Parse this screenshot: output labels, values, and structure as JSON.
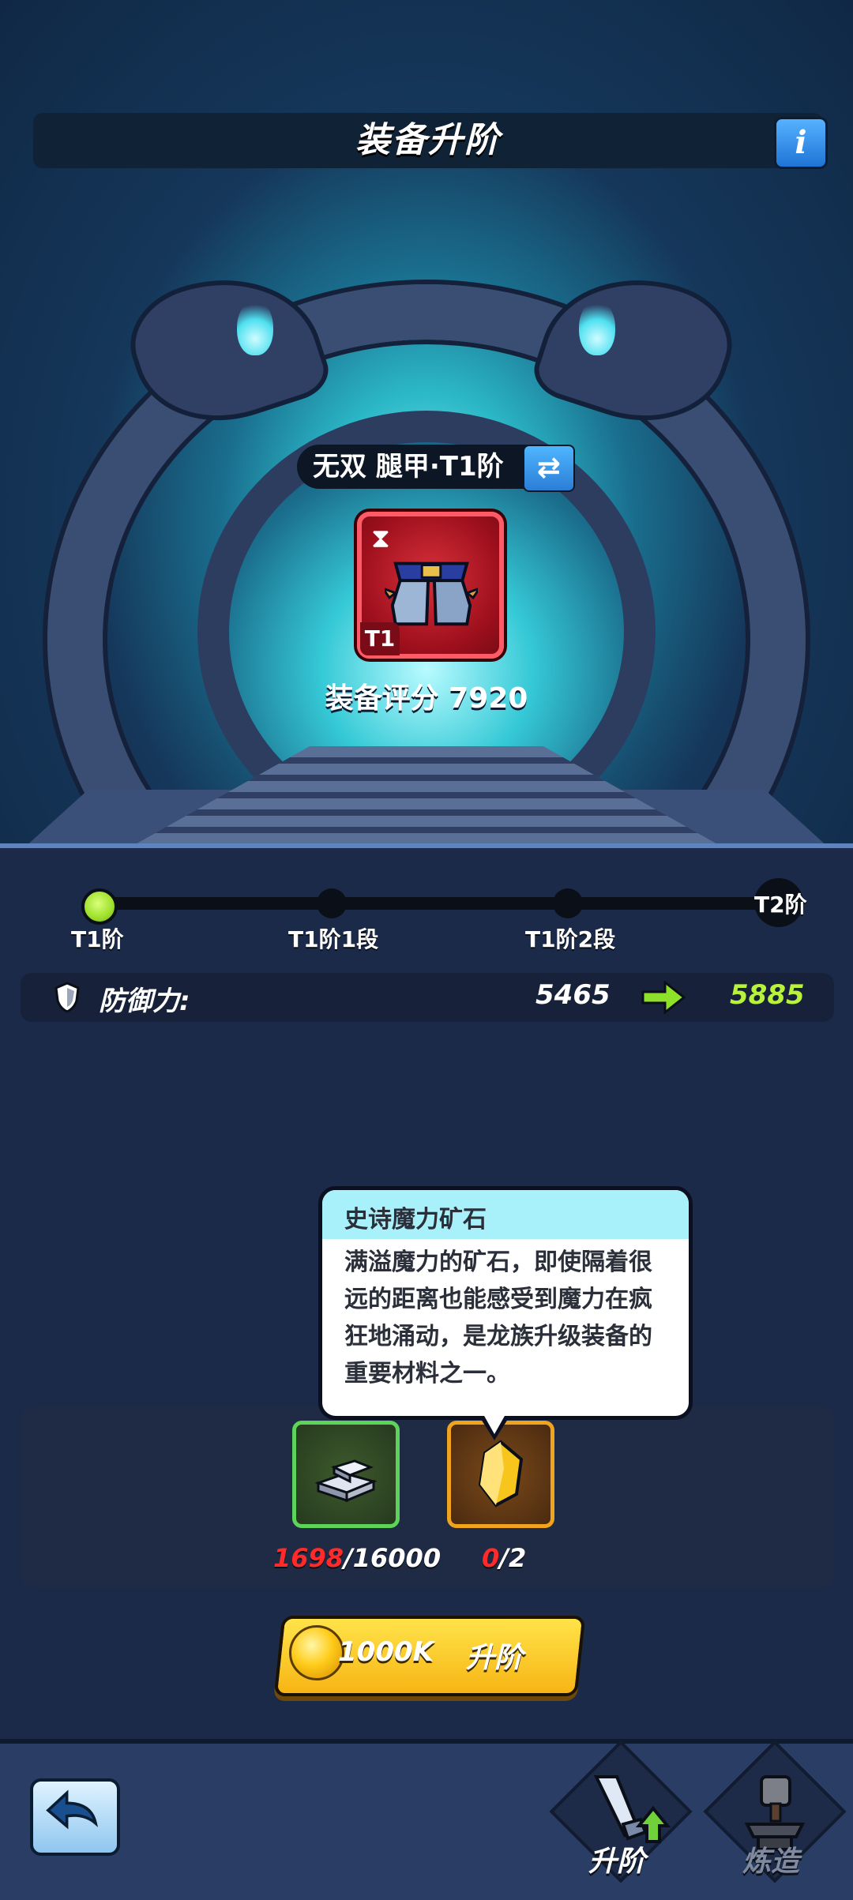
{
  "header": {
    "title": "装备升阶",
    "info_icon": "info-icon"
  },
  "item": {
    "name": "无双 腿甲·T1阶",
    "tier_badge": "T1",
    "score_text": "装备评分 7920",
    "frame_color": "#ff5a66"
  },
  "progress": {
    "stages": [
      "T1阶",
      "T1阶1段",
      "T1阶2段",
      "T2阶"
    ],
    "current_index": 0,
    "accent_color": "#9de02a"
  },
  "stat": {
    "label": "防御力:",
    "current": "5465",
    "next": "5885",
    "next_color": "#b8f23a"
  },
  "tooltip": {
    "title": "史诗魔力矿石",
    "description": "满溢魔力的矿石，即使隔着很远的距离也能感受到魔力在疯狂地涌动，是龙族升级装备的重要材料之一。"
  },
  "materials": [
    {
      "icon": "iron-ingot-icon",
      "have": "1698",
      "need": "/16000"
    },
    {
      "icon": "magic-ore-icon",
      "have": "0",
      "need": "/2"
    }
  ],
  "upgrade_button": {
    "cost": "1000K",
    "label": "升阶"
  },
  "bottom_nav": {
    "upgrade_label": "升阶",
    "forge_label": "炼造"
  }
}
